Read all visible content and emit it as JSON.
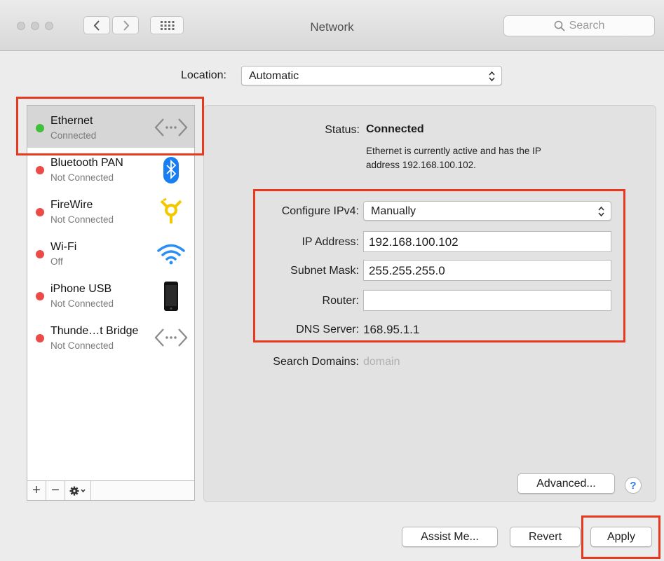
{
  "window": {
    "title": "Network",
    "search_placeholder": "Search"
  },
  "location": {
    "label": "Location:",
    "value": "Automatic"
  },
  "services": [
    {
      "name": "Ethernet",
      "status": "Connected",
      "status_color": "#3fc03a",
      "icon": "ethernet-icon",
      "selected": true
    },
    {
      "name": "Bluetooth PAN",
      "status": "Not Connected",
      "status_color": "#ec4b48",
      "icon": "bluetooth-icon"
    },
    {
      "name": "FireWire",
      "status": "Not Connected",
      "status_color": "#ec4b48",
      "icon": "firewire-icon"
    },
    {
      "name": "Wi-Fi",
      "status": "Off",
      "status_color": "#ec4b48",
      "icon": "wifi-icon"
    },
    {
      "name": "iPhone USB",
      "status": "Not Connected",
      "status_color": "#ec4b48",
      "icon": "iphone-icon"
    },
    {
      "name": "Thunde…t Bridge",
      "status": "Not Connected",
      "status_color": "#ec4b48",
      "icon": "thunderbolt-bridge-icon"
    }
  ],
  "sidebar_toolbar": {
    "add": "+",
    "remove": "−"
  },
  "detail": {
    "status_label": "Status:",
    "status_value": "Connected",
    "status_desc_line1": "Ethernet is currently active and has the IP",
    "status_desc_line2": "address 192.168.100.102.",
    "configure_label": "Configure IPv4:",
    "configure_value": "Manually",
    "ip_label": "IP Address:",
    "ip_value": "192.168.100.102",
    "subnet_label": "Subnet Mask:",
    "subnet_value": "255.255.255.0",
    "router_label": "Router:",
    "router_value": "",
    "dns_label": "DNS Server:",
    "dns_value": "168.95.1.1",
    "search_domains_label": "Search Domains:",
    "search_domains_placeholder": "domain"
  },
  "buttons": {
    "advanced": "Advanced...",
    "help": "?",
    "assist": "Assist Me...",
    "revert": "Revert",
    "apply": "Apply"
  },
  "colors": {
    "highlight_box": "#e8381d",
    "connected": "#3fc03a",
    "disconnected": "#ec4b48",
    "bluetooth_blue": "#1a7ef3",
    "wifi_blue": "#2a8ef7",
    "firewire_yellow": "#f4c800"
  }
}
